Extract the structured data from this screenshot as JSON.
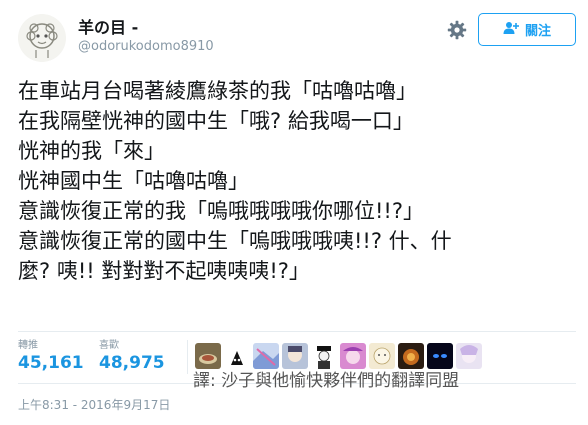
{
  "user": {
    "display_name": "羊の目 -",
    "handle": "@odorukodomo8910",
    "avatar_icon": "sheep-avatar-icon"
  },
  "actions": {
    "settings_icon": "gear-icon",
    "follow_icon": "add-user-icon",
    "follow_label": "關注",
    "accent_color": "#1da1f2"
  },
  "tweet": {
    "lines": [
      "在車站月台喝著綾鷹綠茶的我「咕嚕咕嚕」",
      "在我隔壁恍神的國中生「哦? 給我喝一口」",
      "恍神的我「來」",
      "恍神國中生「咕嚕咕嚕」",
      "意識恢復正常的我「嗚哦哦哦哦你哪位!!?」",
      "意識恢復正常的國中生「嗚哦哦哦咦!!? 什、什",
      "麼? 咦!! 對對對不起咦咦咦!?」"
    ]
  },
  "stats": {
    "retweets_label": "轉推",
    "retweets_value": "45,161",
    "likes_label": "喜歡",
    "likes_value": "48,975"
  },
  "liked_by_avatars": [
    "user-avatar-1",
    "user-avatar-2",
    "user-avatar-3",
    "user-avatar-4",
    "user-avatar-5",
    "user-avatar-6",
    "user-avatar-7",
    "user-avatar-8",
    "user-avatar-9"
  ],
  "watermark": "譯: 沙子與他愉快夥伴們的翻譯同盟",
  "timestamp": "上午8:31 - 2016年9月17日"
}
